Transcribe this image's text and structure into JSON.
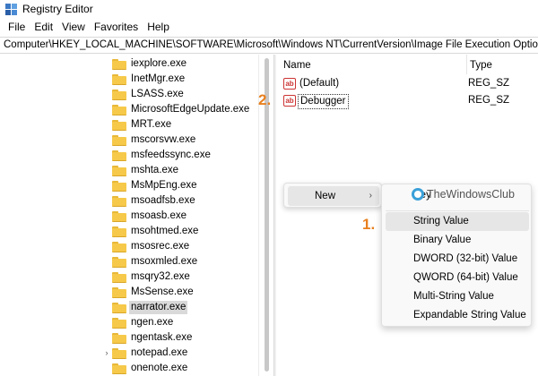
{
  "window": {
    "title": "Registry Editor"
  },
  "menubar": [
    "File",
    "Edit",
    "View",
    "Favorites",
    "Help"
  ],
  "address": "Computer\\HKEY_LOCAL_MACHINE\\SOFTWARE\\Microsoft\\Windows NT\\CurrentVersion\\Image File Execution Options\\",
  "tree": [
    {
      "label": "iexplore.exe",
      "expander": ""
    },
    {
      "label": "InetMgr.exe",
      "expander": ""
    },
    {
      "label": "LSASS.exe",
      "expander": ""
    },
    {
      "label": "MicrosoftEdgeUpdate.exe",
      "expander": ""
    },
    {
      "label": "MRT.exe",
      "expander": ""
    },
    {
      "label": "mscorsvw.exe",
      "expander": ""
    },
    {
      "label": "msfeedssync.exe",
      "expander": ""
    },
    {
      "label": "mshta.exe",
      "expander": ""
    },
    {
      "label": "MsMpEng.exe",
      "expander": ""
    },
    {
      "label": "msoadfsb.exe",
      "expander": ""
    },
    {
      "label": "msoasb.exe",
      "expander": ""
    },
    {
      "label": "msohtmed.exe",
      "expander": ""
    },
    {
      "label": "msosrec.exe",
      "expander": ""
    },
    {
      "label": "msoxmled.exe",
      "expander": ""
    },
    {
      "label": "msqry32.exe",
      "expander": ""
    },
    {
      "label": "MsSense.exe",
      "expander": ""
    },
    {
      "label": "narrator.exe",
      "expander": "",
      "selected": true
    },
    {
      "label": "ngen.exe",
      "expander": ""
    },
    {
      "label": "ngentask.exe",
      "expander": ""
    },
    {
      "label": "notepad.exe",
      "expander": "›"
    },
    {
      "label": "onenote.exe",
      "expander": ""
    }
  ],
  "values_pane": {
    "headers": {
      "name": "Name",
      "type": "Type"
    },
    "rows": [
      {
        "icon": "ab",
        "name": "(Default)",
        "type": "REG_SZ"
      },
      {
        "icon": "ab",
        "name": "Debugger",
        "type": "REG_SZ",
        "editing": true
      }
    ]
  },
  "annotations": {
    "step1": "1.",
    "step2": "2."
  },
  "context_menu": {
    "new_label": "New",
    "arrow": "›"
  },
  "submenu": {
    "key_label": "Key",
    "items": [
      "String Value",
      "Binary Value",
      "DWORD (32-bit) Value",
      "QWORD (64-bit) Value",
      "Multi-String Value",
      "Expandable String Value"
    ]
  },
  "watermark": {
    "text": "TheWindowsClub"
  },
  "colors": {
    "accent": "#e8801f",
    "selection": "#d9d9d9",
    "folder": "#f6c94a"
  }
}
